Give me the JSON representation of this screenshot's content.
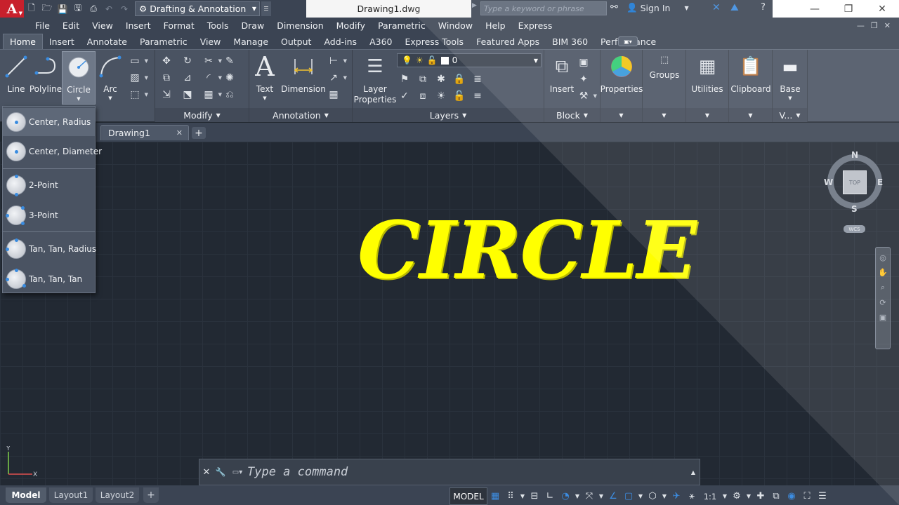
{
  "titlebar": {
    "workspace": "Drafting & Annotation",
    "doc_title": "Drawing1.dwg",
    "search_placeholder": "Type a keyword or phrase",
    "signin": "Sign In"
  },
  "menu": [
    "File",
    "Edit",
    "View",
    "Insert",
    "Format",
    "Tools",
    "Draw",
    "Dimension",
    "Modify",
    "Parametric",
    "Window",
    "Help",
    "Express"
  ],
  "ribbon_tabs": [
    "Home",
    "Insert",
    "Annotate",
    "Parametric",
    "View",
    "Manage",
    "Output",
    "Add-ins",
    "A360",
    "Express Tools",
    "Featured Apps",
    "BIM 360",
    "Performance"
  ],
  "ribbon": {
    "draw": {
      "line": "Line",
      "polyline": "Polyline",
      "circle": "Circle",
      "arc": "Arc"
    },
    "modify": {
      "title": "Modify"
    },
    "annotation": {
      "text": "Text",
      "dimension": "Dimension",
      "title": "Annotation"
    },
    "layers": {
      "layer_properties_1": "Layer",
      "layer_properties_2": "Properties",
      "current_layer": "0",
      "title": "Layers"
    },
    "block": {
      "insert": "Insert",
      "title": "Block"
    },
    "properties": {
      "label": "Properties"
    },
    "groups": {
      "label": "Groups"
    },
    "utilities": {
      "label": "Utilities"
    },
    "clipboard": {
      "label": "Clipboard"
    },
    "view": {
      "base": "Base",
      "title": "V..."
    }
  },
  "circle_menu": [
    "Center, Radius",
    "Center, Diameter",
    "2-Point",
    "3-Point",
    "Tan, Tan, Radius",
    "Tan, Tan, Tan"
  ],
  "doc_tab": "Drawing1",
  "canvas": {
    "title": "CIRCLE"
  },
  "viewcube": {
    "n": "N",
    "s": "S",
    "e": "E",
    "w": "W",
    "top": "TOP",
    "wcs": "WCS"
  },
  "ucs": {
    "x": "X",
    "y": "Y"
  },
  "command": {
    "placeholder": "Type a command"
  },
  "layout_tabs": [
    "Model",
    "Layout1",
    "Layout2"
  ],
  "status": {
    "model": "MODEL",
    "scale": "1:1"
  }
}
